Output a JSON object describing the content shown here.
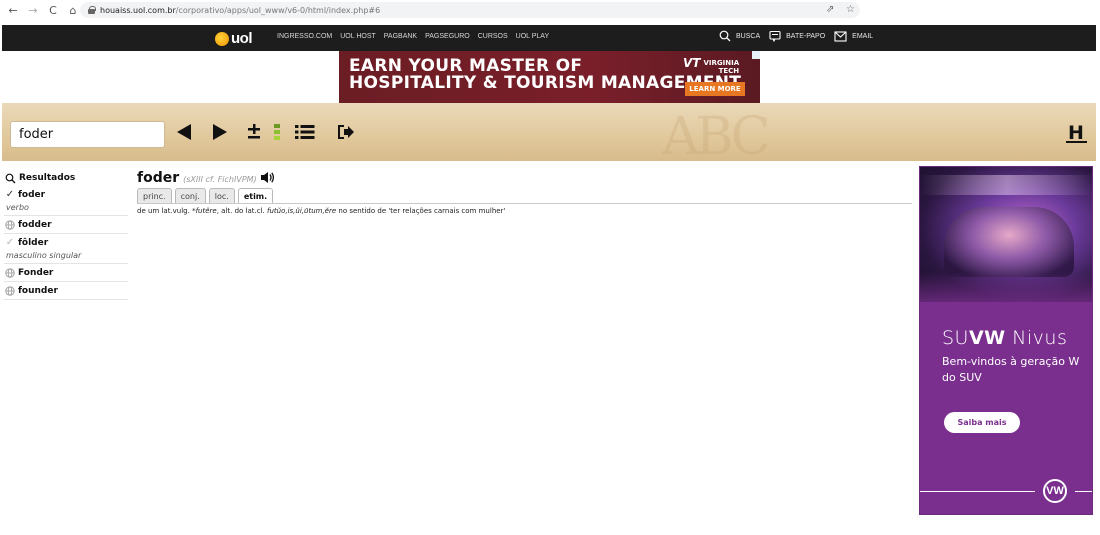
{
  "browser": {
    "url_host": "houaiss.uol.com.br",
    "url_path": "/corporativo/apps/uol_www/v6-0/html/index.php#6"
  },
  "uol_bar": {
    "logo_text": "uol",
    "links": [
      "INGRESSO.COM",
      "UOL HOST",
      "PAGBANK",
      "PAGSEGURO",
      "CURSOS",
      "UOL PLAY"
    ],
    "busca": "BUSCA",
    "bate_papo": "BATE-PAPO",
    "email": "EMAIL"
  },
  "banner_ad": {
    "headline_line1": "EARN YOUR MASTER OF",
    "headline_line2": "HOSPITALITY & TOURISM MANAGEMENT",
    "brand_mark": "VT",
    "brand_line1": "VIRGINIA",
    "brand_line2": "TECH",
    "cta": "LEARN MORE",
    "color": "#7a1f2a",
    "cta_color": "#e87722"
  },
  "search": {
    "value": "foder"
  },
  "toolbar": {
    "logo_letter": "H"
  },
  "sidebar": {
    "title": "Resultados",
    "items": [
      {
        "word": "foder",
        "sub": "verbo",
        "mark": "check"
      },
      {
        "word": "fodder",
        "sub": "",
        "mark": "globe"
      },
      {
        "word": "fôlder",
        "sub": "masculino singular",
        "mark": "check-light"
      },
      {
        "word": "Fonder",
        "sub": "",
        "mark": "globe"
      },
      {
        "word": "founder",
        "sub": "",
        "mark": "globe"
      }
    ]
  },
  "entry": {
    "word": "foder",
    "meta": "(sXIII cf. FichIVPM)",
    "tabs": [
      "princ.",
      "conj.",
      "loc.",
      "etim."
    ],
    "active_tab": "etim.",
    "etym": {
      "t1": "de um lat.vulg. ",
      "i1": "*futĕre",
      "t2": ", alt. do lat.cl. ",
      "i2": "futŭo,is,ŭi,ūtum,ĕre",
      "t3": " no sentido de 'ter relações carnais com mulher'"
    }
  },
  "side_ad": {
    "brand_light": "SU",
    "brand_bold": "VW",
    "brand_model": " Nivus",
    "copy": "Bem-vindos à geração W do SUV",
    "cta": "Saiba mais",
    "logo": "VW",
    "color": "#7a2f8e"
  }
}
